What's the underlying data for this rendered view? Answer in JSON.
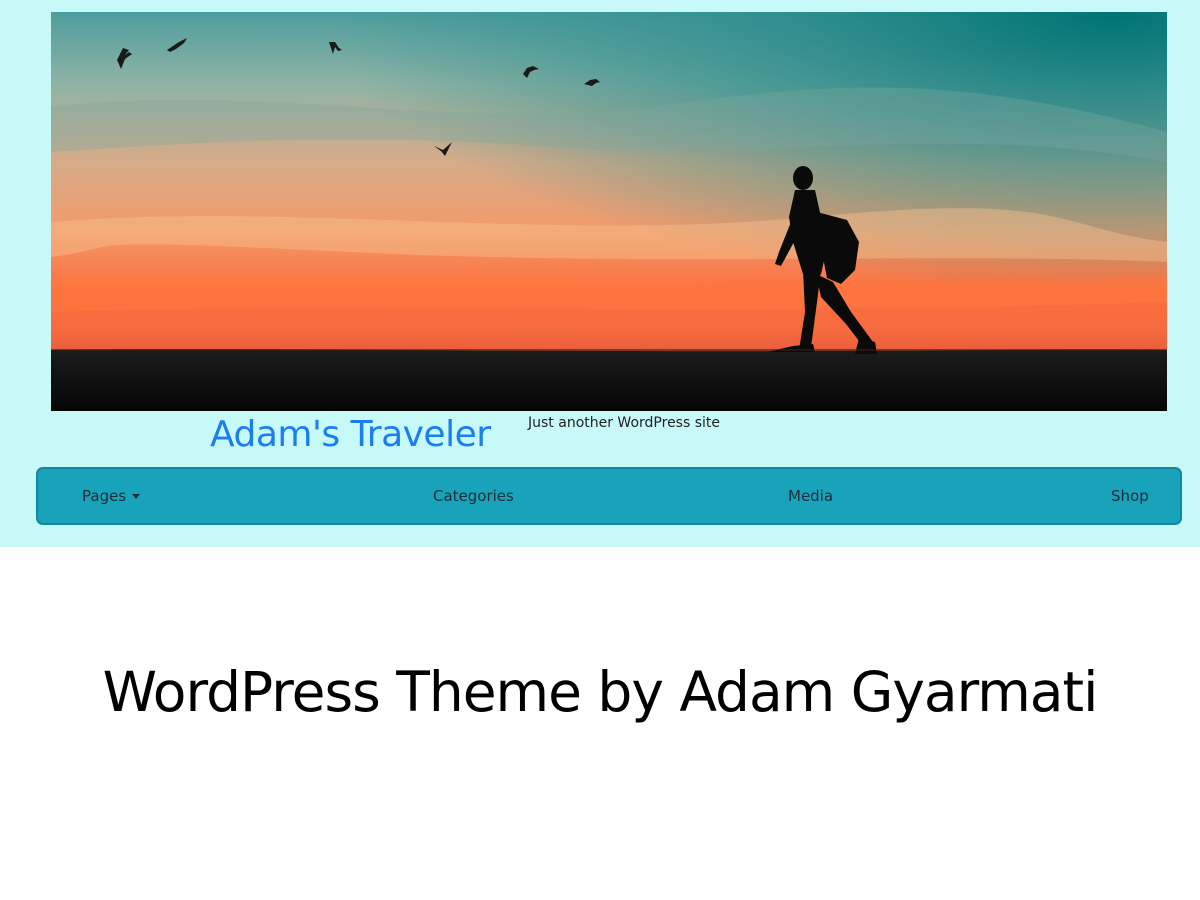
{
  "header": {
    "site_title": "Adam's Traveler",
    "tagline": "Just another WordPress site",
    "hero_image": "sunset-traveler-silhouette"
  },
  "nav": {
    "items": [
      {
        "label": "Pages",
        "has_dropdown": true
      },
      {
        "label": "Categories"
      },
      {
        "label": "Media"
      },
      {
        "label": "Shop"
      }
    ]
  },
  "footer": {
    "credit": "WordPress Theme by Adam Gyarmati"
  },
  "colors": {
    "background": "#c6f9f7",
    "navbar": "#18a3bb",
    "title": "#1a7ef2"
  }
}
